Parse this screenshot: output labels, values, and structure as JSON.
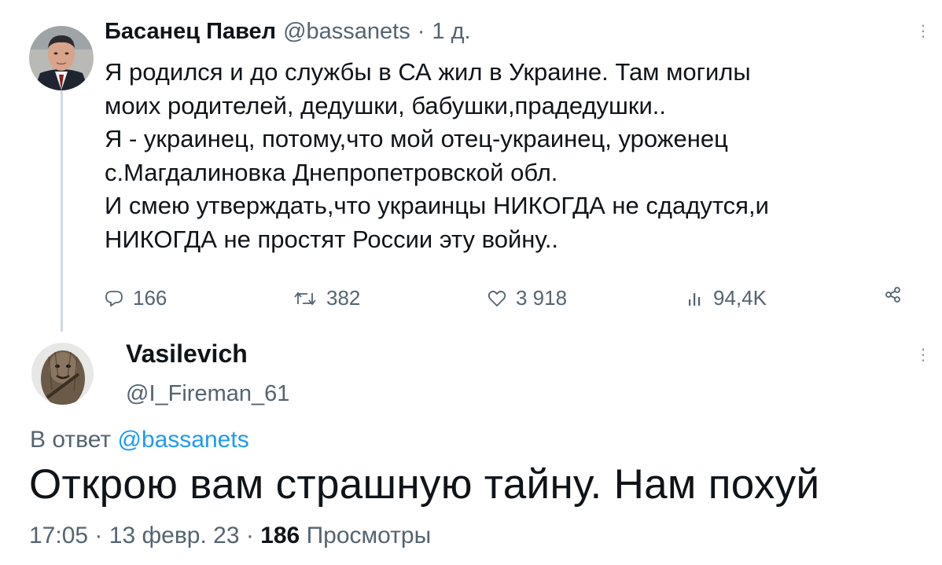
{
  "original_tweet": {
    "author_name": "Басанец Павел",
    "handle": "@bassanets",
    "separator": "·",
    "time_ago": "1 д.",
    "lines": [
      "Я родился и до службы в СА жил в Украине. Там могилы",
      "моих родителей, дедушки, бабушки,прадедушки..",
      "Я - украинец, потому,что мой отец-украинец, уроженец",
      "с.Магдалиновка Днепропетровской обл.",
      "И  смею утверждать,что украинцы НИКОГДА не сдадутся,и",
      "НИКОГДА не простят России эту войну.."
    ],
    "stats": {
      "replies": "166",
      "retweets": "382",
      "likes": "3 918",
      "views": "94,4K"
    },
    "icons": [
      "reply-icon",
      "retweet-icon",
      "like-icon",
      "views-icon",
      "share-icon",
      "more-icon"
    ]
  },
  "reply_tweet": {
    "author_name": "Vasilevich",
    "handle": "@I_Fireman_61",
    "in_reply_prefix": "В ответ",
    "in_reply_handle": "@bassanets",
    "text": "Открою вам страшную тайну. Нам похуй",
    "time": "17:05",
    "separator": "·",
    "date": "13 февр. 23",
    "views_count": "186",
    "views_label": "Просмотры"
  },
  "colors": {
    "text": "#0f1419",
    "secondary": "#536471",
    "link": "#1d9bf0",
    "thread_line": "#cfd9de"
  }
}
